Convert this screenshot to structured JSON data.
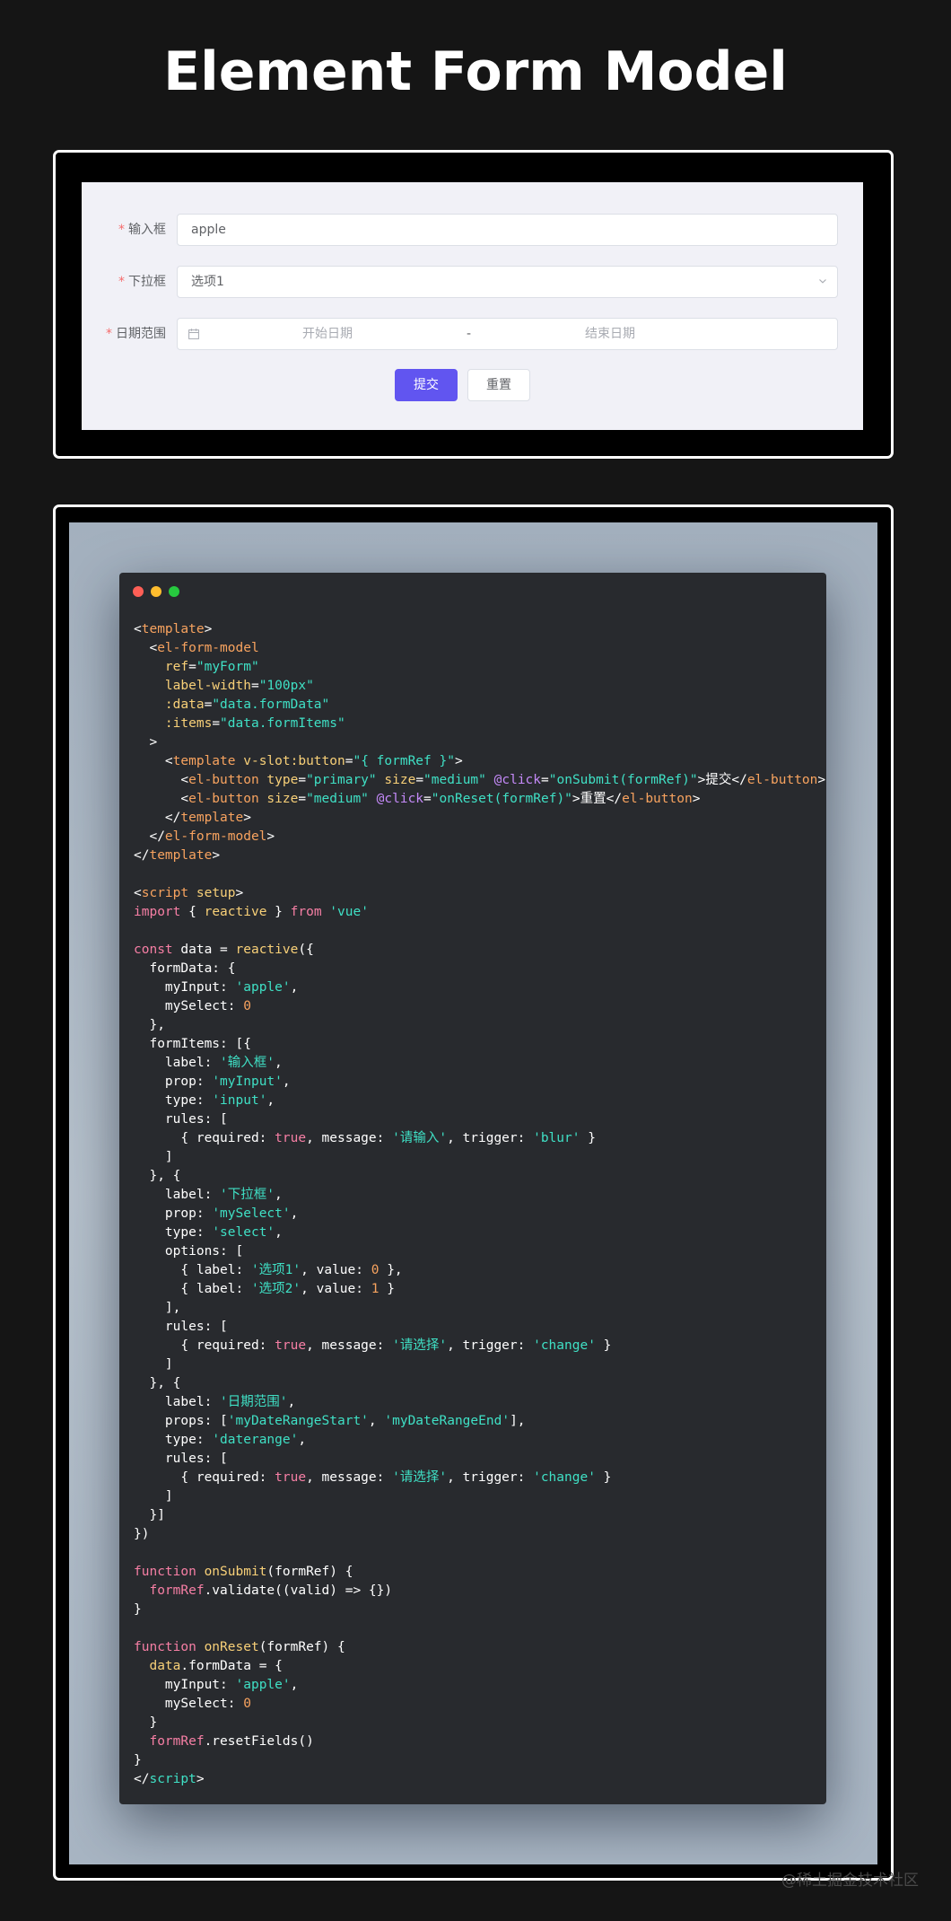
{
  "page": {
    "title": "Element Form Model",
    "watermark": "@稀土掘金技术社区"
  },
  "form": {
    "required_mark": "*",
    "fields": [
      {
        "label": "输入框",
        "value": "apple"
      },
      {
        "label": "下拉框",
        "value": "选项1"
      },
      {
        "label": "日期范围",
        "start_placeholder": "开始日期",
        "separator": "-",
        "end_placeholder": "结束日期"
      }
    ],
    "submit_label": "提交",
    "reset_label": "重置"
  },
  "colors": {
    "tag": "#f8a35f",
    "attr": "#f8d078",
    "attr2": "#c58af9",
    "string": "#3fe0c5",
    "keyword": "#f77fa5",
    "number": "#f8a35f",
    "plain": "#ffffff",
    "primary": "#6155f0"
  },
  "code": {
    "window_dots": [
      "red-dot",
      "yellow-dot",
      "green-dot"
    ],
    "lines": [
      [
        [
          "p",
          "<"
        ],
        [
          "t",
          "template"
        ],
        [
          "p",
          ">"
        ]
      ],
      [
        [
          "p",
          "  <"
        ],
        [
          "t",
          "el-form-model"
        ]
      ],
      [
        [
          "p",
          "    "
        ],
        [
          "a",
          "ref"
        ],
        [
          "p",
          "="
        ],
        [
          "s",
          "\"myForm\""
        ]
      ],
      [
        [
          "p",
          "    "
        ],
        [
          "a",
          "label-width"
        ],
        [
          "p",
          "="
        ],
        [
          "s",
          "\"100px\""
        ]
      ],
      [
        [
          "p",
          "    "
        ],
        [
          "a",
          ":data"
        ],
        [
          "p",
          "="
        ],
        [
          "s",
          "\"data.formData\""
        ]
      ],
      [
        [
          "p",
          "    "
        ],
        [
          "a",
          ":items"
        ],
        [
          "p",
          "="
        ],
        [
          "s",
          "\"data.formItems\""
        ]
      ],
      [
        [
          "p",
          "  >"
        ]
      ],
      [
        [
          "p",
          "    <"
        ],
        [
          "t",
          "template"
        ],
        [
          "p",
          " "
        ],
        [
          "a",
          "v-slot:button"
        ],
        [
          "p",
          "="
        ],
        [
          "s",
          "\"{ formRef }\""
        ],
        [
          "p",
          ">"
        ]
      ],
      [
        [
          "p",
          "      <"
        ],
        [
          "t",
          "el-button"
        ],
        [
          "p",
          " "
        ],
        [
          "a",
          "type"
        ],
        [
          "p",
          "="
        ],
        [
          "s",
          "\"primary\""
        ],
        [
          "p",
          " "
        ],
        [
          "a",
          "size"
        ],
        [
          "p",
          "="
        ],
        [
          "s",
          "\"medium\""
        ],
        [
          "p",
          " "
        ],
        [
          "v",
          "@click"
        ],
        [
          "p",
          "="
        ],
        [
          "s",
          "\"onSubmit(formRef)\""
        ],
        [
          "p",
          ">提交</"
        ],
        [
          "t",
          "el-button"
        ],
        [
          "p",
          ">"
        ]
      ],
      [
        [
          "p",
          "      <"
        ],
        [
          "t",
          "el-button"
        ],
        [
          "p",
          " "
        ],
        [
          "a",
          "size"
        ],
        [
          "p",
          "="
        ],
        [
          "s",
          "\"medium\""
        ],
        [
          "p",
          " "
        ],
        [
          "v",
          "@click"
        ],
        [
          "p",
          "="
        ],
        [
          "s",
          "\"onReset(formRef)\""
        ],
        [
          "p",
          ">重置</"
        ],
        [
          "t",
          "el-button"
        ],
        [
          "p",
          ">"
        ]
      ],
      [
        [
          "p",
          "    </"
        ],
        [
          "t",
          "template"
        ],
        [
          "p",
          ">"
        ]
      ],
      [
        [
          "p",
          "  </"
        ],
        [
          "t",
          "el-form-model"
        ],
        [
          "p",
          ">"
        ]
      ],
      [
        [
          "p",
          "</"
        ],
        [
          "t",
          "template"
        ],
        [
          "p",
          ">"
        ]
      ],
      [],
      [
        [
          "p",
          "<"
        ],
        [
          "t",
          "script"
        ],
        [
          "p",
          " "
        ],
        [
          "a",
          "setup"
        ],
        [
          "p",
          ">"
        ]
      ],
      [
        [
          "k",
          "import"
        ],
        [
          "p",
          " { "
        ],
        [
          "a",
          "reactive"
        ],
        [
          "p",
          " } "
        ],
        [
          "k",
          "from"
        ],
        [
          "p",
          " "
        ],
        [
          "s",
          "'vue'"
        ]
      ],
      [],
      [
        [
          "k",
          "const"
        ],
        [
          "p",
          " data = "
        ],
        [
          "a",
          "reactive"
        ],
        [
          "p",
          "({"
        ]
      ],
      [
        [
          "p",
          "  formData: {"
        ]
      ],
      [
        [
          "p",
          "    myInput: "
        ],
        [
          "s",
          "'apple'"
        ],
        [
          "p",
          ","
        ]
      ],
      [
        [
          "p",
          "    mySelect: "
        ],
        [
          "n",
          "0"
        ]
      ],
      [
        [
          "p",
          "  },"
        ]
      ],
      [
        [
          "p",
          "  formItems: [{"
        ]
      ],
      [
        [
          "p",
          "    label: "
        ],
        [
          "s",
          "'输入框'"
        ],
        [
          "p",
          ","
        ]
      ],
      [
        [
          "p",
          "    prop: "
        ],
        [
          "s",
          "'myInput'"
        ],
        [
          "p",
          ","
        ]
      ],
      [
        [
          "p",
          "    type: "
        ],
        [
          "s",
          "'input'"
        ],
        [
          "p",
          ","
        ]
      ],
      [
        [
          "p",
          "    rules: ["
        ]
      ],
      [
        [
          "p",
          "      { required: "
        ],
        [
          "k",
          "true"
        ],
        [
          "p",
          ", message: "
        ],
        [
          "s",
          "'请输入'"
        ],
        [
          "p",
          ", trigger: "
        ],
        [
          "s",
          "'blur'"
        ],
        [
          "p",
          " }"
        ]
      ],
      [
        [
          "p",
          "    ]"
        ]
      ],
      [
        [
          "p",
          "  }, {"
        ]
      ],
      [
        [
          "p",
          "    label: "
        ],
        [
          "s",
          "'下拉框'"
        ],
        [
          "p",
          ","
        ]
      ],
      [
        [
          "p",
          "    prop: "
        ],
        [
          "s",
          "'mySelect'"
        ],
        [
          "p",
          ","
        ]
      ],
      [
        [
          "p",
          "    type: "
        ],
        [
          "s",
          "'select'"
        ],
        [
          "p",
          ","
        ]
      ],
      [
        [
          "p",
          "    options: ["
        ]
      ],
      [
        [
          "p",
          "      { label: "
        ],
        [
          "s",
          "'选项1'"
        ],
        [
          "p",
          ", value: "
        ],
        [
          "n",
          "0"
        ],
        [
          "p",
          " },"
        ]
      ],
      [
        [
          "p",
          "      { label: "
        ],
        [
          "s",
          "'选项2'"
        ],
        [
          "p",
          ", value: "
        ],
        [
          "n",
          "1"
        ],
        [
          "p",
          " }"
        ]
      ],
      [
        [
          "p",
          "    ],"
        ]
      ],
      [
        [
          "p",
          "    rules: ["
        ]
      ],
      [
        [
          "p",
          "      { required: "
        ],
        [
          "k",
          "true"
        ],
        [
          "p",
          ", message: "
        ],
        [
          "s",
          "'请选择'"
        ],
        [
          "p",
          ", trigger: "
        ],
        [
          "s",
          "'change'"
        ],
        [
          "p",
          " }"
        ]
      ],
      [
        [
          "p",
          "    ]"
        ]
      ],
      [
        [
          "p",
          "  }, {"
        ]
      ],
      [
        [
          "p",
          "    label: "
        ],
        [
          "s",
          "'日期范围'"
        ],
        [
          "p",
          ","
        ]
      ],
      [
        [
          "p",
          "    props: ["
        ],
        [
          "s",
          "'myDateRangeStart'"
        ],
        [
          "p",
          ", "
        ],
        [
          "s",
          "'myDateRangeEnd'"
        ],
        [
          "p",
          "],"
        ]
      ],
      [
        [
          "p",
          "    type: "
        ],
        [
          "s",
          "'daterange'"
        ],
        [
          "p",
          ","
        ]
      ],
      [
        [
          "p",
          "    rules: ["
        ]
      ],
      [
        [
          "p",
          "      { required: "
        ],
        [
          "k",
          "true"
        ],
        [
          "p",
          ", message: "
        ],
        [
          "s",
          "'请选择'"
        ],
        [
          "p",
          ", trigger: "
        ],
        [
          "s",
          "'change'"
        ],
        [
          "p",
          " }"
        ]
      ],
      [
        [
          "p",
          "    ]"
        ]
      ],
      [
        [
          "p",
          "  }]"
        ]
      ],
      [
        [
          "p",
          "})"
        ]
      ],
      [],
      [
        [
          "k",
          "function"
        ],
        [
          "p",
          " "
        ],
        [
          "a",
          "onSubmit"
        ],
        [
          "p",
          "(formRef) {"
        ]
      ],
      [
        [
          "p",
          "  "
        ],
        [
          "k",
          "formRef"
        ],
        [
          "p",
          ".validate((valid) => {})"
        ]
      ],
      [
        [
          "p",
          "}"
        ]
      ],
      [],
      [
        [
          "k",
          "function"
        ],
        [
          "p",
          " "
        ],
        [
          "a",
          "onReset"
        ],
        [
          "p",
          "(formRef) {"
        ]
      ],
      [
        [
          "p",
          "  "
        ],
        [
          "a",
          "data"
        ],
        [
          "p",
          ".formData = {"
        ]
      ],
      [
        [
          "p",
          "    myInput: "
        ],
        [
          "s",
          "'apple'"
        ],
        [
          "p",
          ","
        ]
      ],
      [
        [
          "p",
          "    mySelect: "
        ],
        [
          "n",
          "0"
        ]
      ],
      [
        [
          "p",
          "  }"
        ]
      ],
      [
        [
          "p",
          "  "
        ],
        [
          "k",
          "formRef"
        ],
        [
          "p",
          ".resetFields()"
        ]
      ],
      [
        [
          "p",
          "}"
        ]
      ],
      [
        [
          "p",
          "</"
        ],
        [
          "g",
          "script"
        ],
        [
          "p",
          ">"
        ]
      ]
    ]
  }
}
